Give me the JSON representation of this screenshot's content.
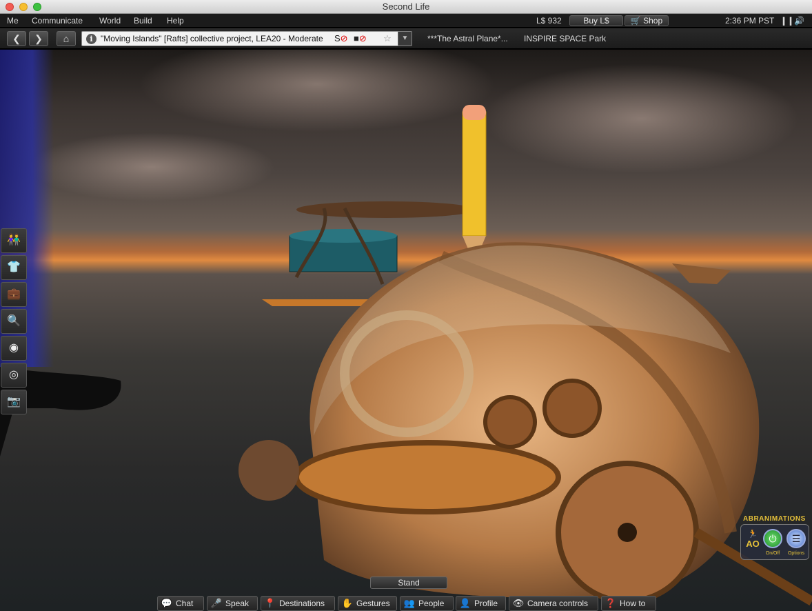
{
  "window": {
    "title": "Second Life"
  },
  "menu": {
    "items": [
      "Me",
      "Communicate",
      "World",
      "Build",
      "Help"
    ],
    "balance": "L$ 932",
    "buy_label": "Buy L$",
    "shop_label": "Shop",
    "clock": "2:36 PM PST"
  },
  "nav": {
    "location": "\"Moving Islands\" [Rafts] collective project, LEA20 - Moderate",
    "favorites": [
      "***The Astral Plane*...",
      "INSPIRE SPACE Park"
    ]
  },
  "bottom": {
    "stand_label": "Stand",
    "buttons": [
      "Chat",
      "Speak",
      "Destinations",
      "Gestures",
      "People",
      "Profile",
      "Camera controls",
      "How to"
    ]
  },
  "hud": {
    "title": "ABRANIMATIONS",
    "ao_label": "AO",
    "onoff_label": "On/Off",
    "options_label": "Options"
  },
  "icons": {
    "sidebar": [
      "people-icon",
      "appearance-icon",
      "inventory-icon",
      "search-icon",
      "voice-icon",
      "places-icon",
      "snapshot-icon"
    ]
  },
  "colors": {
    "accent_gold": "#e6c23a",
    "horizon": "#e08a40"
  }
}
